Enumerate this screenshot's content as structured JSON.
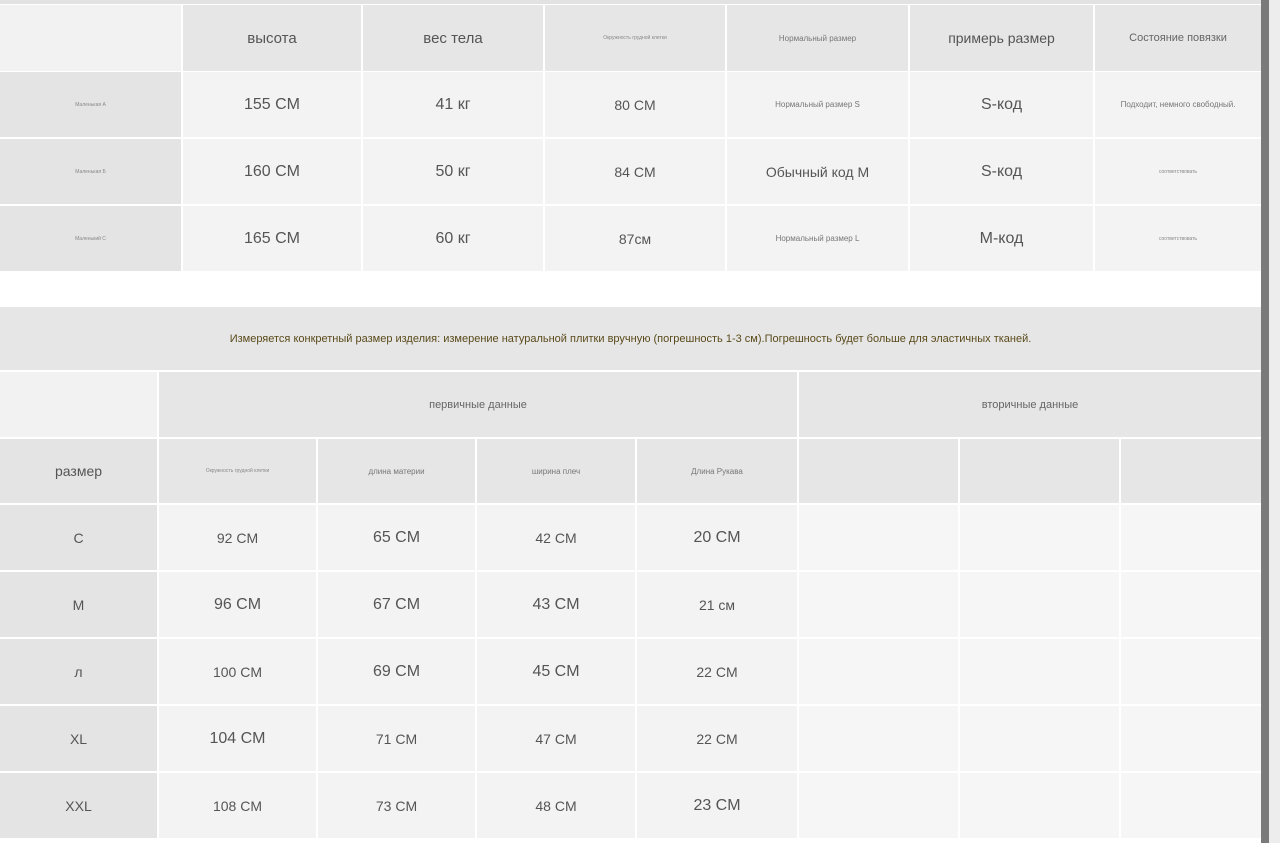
{
  "table1": {
    "headers": [
      "высота",
      "вес тела",
      "Окружность грудной клетки",
      "Нормальный размер",
      "примерь размер",
      "Состояние повязки"
    ],
    "rows": [
      {
        "label": "Маленькая А",
        "height": "155 CM",
        "weight": "41 кг",
        "chest": "80 CM",
        "normal": "Нормальный размер S",
        "tried": "S-код",
        "state": "Подходит, немного свободный."
      },
      {
        "label": "Маленькая Б",
        "height": "160 CM",
        "weight": "50 кг",
        "chest": "84 CM",
        "normal": "Обычный код M",
        "tried": "S-код",
        "state": "соответствовать"
      },
      {
        "label": "Маленький C",
        "height": "165 CM",
        "weight": "60 кг",
        "chest": "87см",
        "normal": "Нормальный размер L",
        "tried": "M-код",
        "state": "соответствовать"
      }
    ]
  },
  "note": "Измеряется конкретный размер изделия: измерение натуральной плитки вручную (погрешность 1-3 см).Погрешность будет больше для эластичных тканей.",
  "table2": {
    "group_primary": "первичные данные",
    "group_secondary": "вторичные данные",
    "size_header": "размер",
    "sub_headers": [
      "Окружность грудной клетки",
      "длина материи",
      "ширина плеч",
      "Длина Рукава"
    ],
    "rows": [
      {
        "size": "С",
        "chest": "92 CM",
        "length": "65 CM",
        "shoulder": "42 CM",
        "sleeve": "20 CM"
      },
      {
        "size": "M",
        "chest": "96 CM",
        "length": "67 CM",
        "shoulder": "43 CM",
        "sleeve": "21 см"
      },
      {
        "size": "л",
        "chest": "100 CM",
        "length": "69 CM",
        "shoulder": "45 CM",
        "sleeve": "22 CM"
      },
      {
        "size": "XL",
        "chest": "104 CM",
        "length": "71 CM",
        "shoulder": "47 CM",
        "sleeve": "22 CM"
      },
      {
        "size": "XXL",
        "chest": "108 CM",
        "length": "73 CM",
        "shoulder": "48 CM",
        "sleeve": "23 CM"
      }
    ]
  }
}
